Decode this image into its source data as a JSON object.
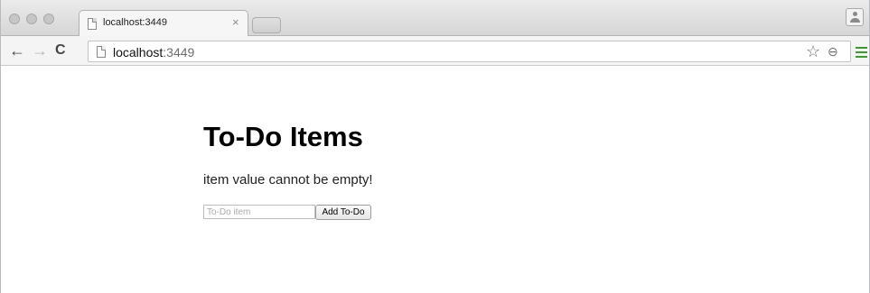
{
  "browser": {
    "tab": {
      "title": "localhost:3449",
      "close_glyph": "×"
    },
    "nav": {
      "back_glyph": "←",
      "forward_glyph": "→",
      "reload_glyph": "C"
    },
    "address": {
      "host": "localhost",
      "port": ":3449"
    },
    "icons": {
      "star_glyph": "☆",
      "zoom_glyph": "⊖"
    }
  },
  "page": {
    "heading": "To-Do Items",
    "message": "item value cannot be empty!",
    "input": {
      "placeholder": "To-Do item",
      "value": ""
    },
    "add_button_label": "Add To-Do"
  },
  "colors": {
    "menu_accent": "#3a9a2a"
  }
}
